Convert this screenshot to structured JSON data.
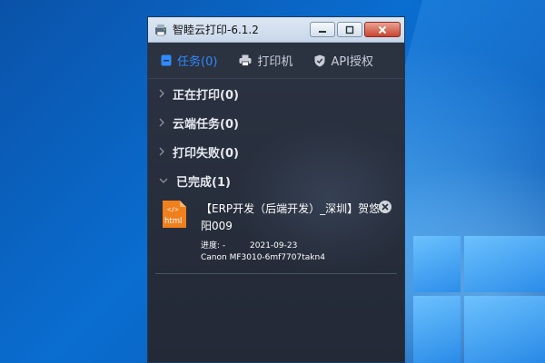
{
  "window": {
    "title": "智睦云打印-6.1.2"
  },
  "tabs": [
    {
      "label": "任务(0)",
      "icon": "task-icon",
      "active": true
    },
    {
      "label": "打印机",
      "icon": "printer-icon",
      "active": false
    },
    {
      "label": "API授权",
      "icon": "shield-icon",
      "active": false
    }
  ],
  "sections": [
    {
      "label": "正在打印(0)",
      "expanded": false
    },
    {
      "label": "云端任务(0)",
      "expanded": false
    },
    {
      "label": "打印失败(0)",
      "expanded": false
    },
    {
      "label": "已完成(1)",
      "expanded": true
    }
  ],
  "completed_jobs": [
    {
      "file_icon": "html-file-icon",
      "file_type_label": "html",
      "title": "【ERP开发（后端开发）_深圳】贺悠阳009",
      "progress_label": "进度: -",
      "date": "2021-09-23",
      "printer": "Canon MF3010-6mf7707takn4"
    }
  ],
  "colors": {
    "accent": "#2f8bff",
    "file_icon": "#f07f1e",
    "window_bg": "#262c38"
  }
}
